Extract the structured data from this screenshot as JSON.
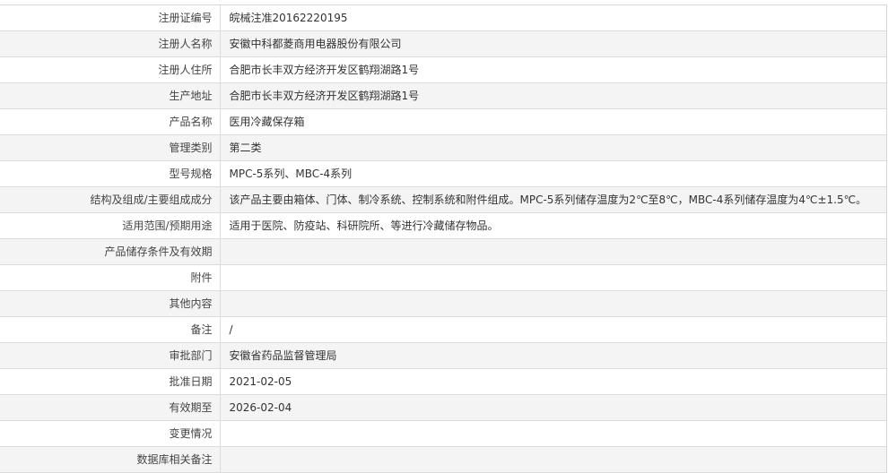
{
  "rows": [
    {
      "label": "注册证编号",
      "value": "皖械注准20162220195"
    },
    {
      "label": "注册人名称",
      "value": "安徽中科都菱商用电器股份有限公司"
    },
    {
      "label": "注册人住所",
      "value": "合肥市长丰双方经济开发区鹤翔湖路1号"
    },
    {
      "label": "生产地址",
      "value": "合肥市长丰双方经济开发区鹤翔湖路1号"
    },
    {
      "label": "产品名称",
      "value": "医用冷藏保存箱"
    },
    {
      "label": "管理类别",
      "value": "第二类"
    },
    {
      "label": "型号规格",
      "value": "MPC-5系列、MBC-4系列"
    },
    {
      "label": "结构及组成/主要组成成分",
      "value": "该产品主要由箱体、门体、制冷系统、控制系统和附件组成。MPC-5系列储存温度为2℃至8℃，MBC-4系列储存温度为4℃±1.5℃。"
    },
    {
      "label": "适用范围/预期用途",
      "value": "适用于医院、防疫站、科研院所、等进行冷藏储存物品。"
    },
    {
      "label": "产品储存条件及有效期",
      "value": ""
    },
    {
      "label": "附件",
      "value": ""
    },
    {
      "label": "其他内容",
      "value": ""
    },
    {
      "label": "备注",
      "value": "/"
    },
    {
      "label": "审批部门",
      "value": "安徽省药品监督管理局"
    },
    {
      "label": "批准日期",
      "value": "2021-02-05"
    },
    {
      "label": "有效期至",
      "value": "2026-02-04"
    },
    {
      "label": "变更情况",
      "value": ""
    },
    {
      "label": "数据库相关备注",
      "value": ""
    }
  ]
}
